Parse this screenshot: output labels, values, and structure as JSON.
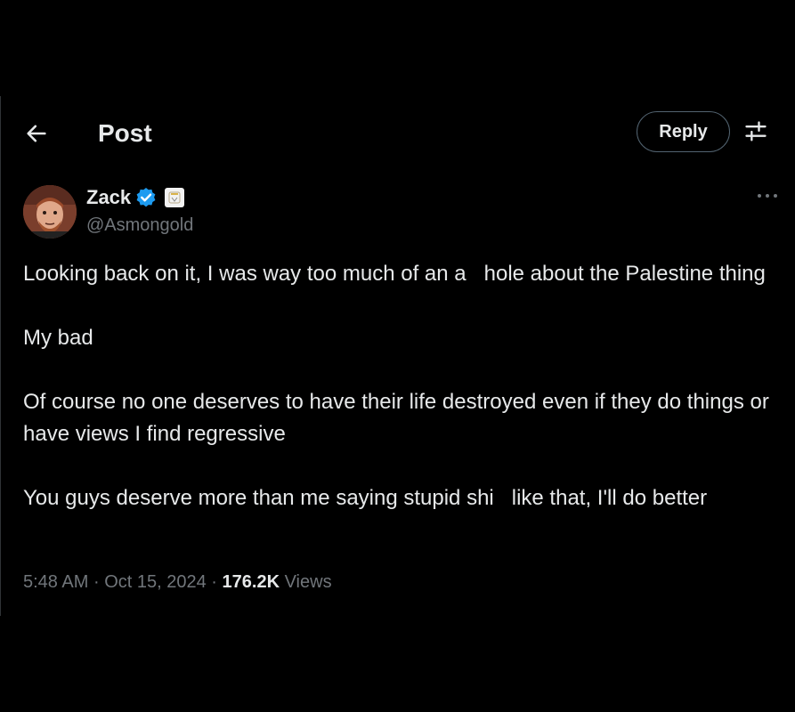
{
  "header": {
    "title": "Post",
    "reply_label": "Reply",
    "back_icon": "arrow-left-icon",
    "settings_icon": "sliders-icon"
  },
  "post": {
    "author": {
      "name": "Zack",
      "handle": "@Asmongold",
      "verified_color": "#1d9bf0"
    },
    "lines": [
      "Looking back on it, I was way too much of an a   hole about the Palestine thing",
      "My bad",
      "Of course no one deserves to have their life destroyed even if they do things or have views I find regressive",
      "You guys deserve more than me saying stupid shi   like that, I'll do better"
    ],
    "meta": {
      "time": "5:48 AM",
      "date": "Oct 15, 2024",
      "separator": "·",
      "views_count": "176.2K",
      "views_label": "Views"
    }
  },
  "colors": {
    "background": "#000000",
    "text_primary": "#e7e9ea",
    "text_secondary": "#71767b",
    "border": "#536471"
  }
}
